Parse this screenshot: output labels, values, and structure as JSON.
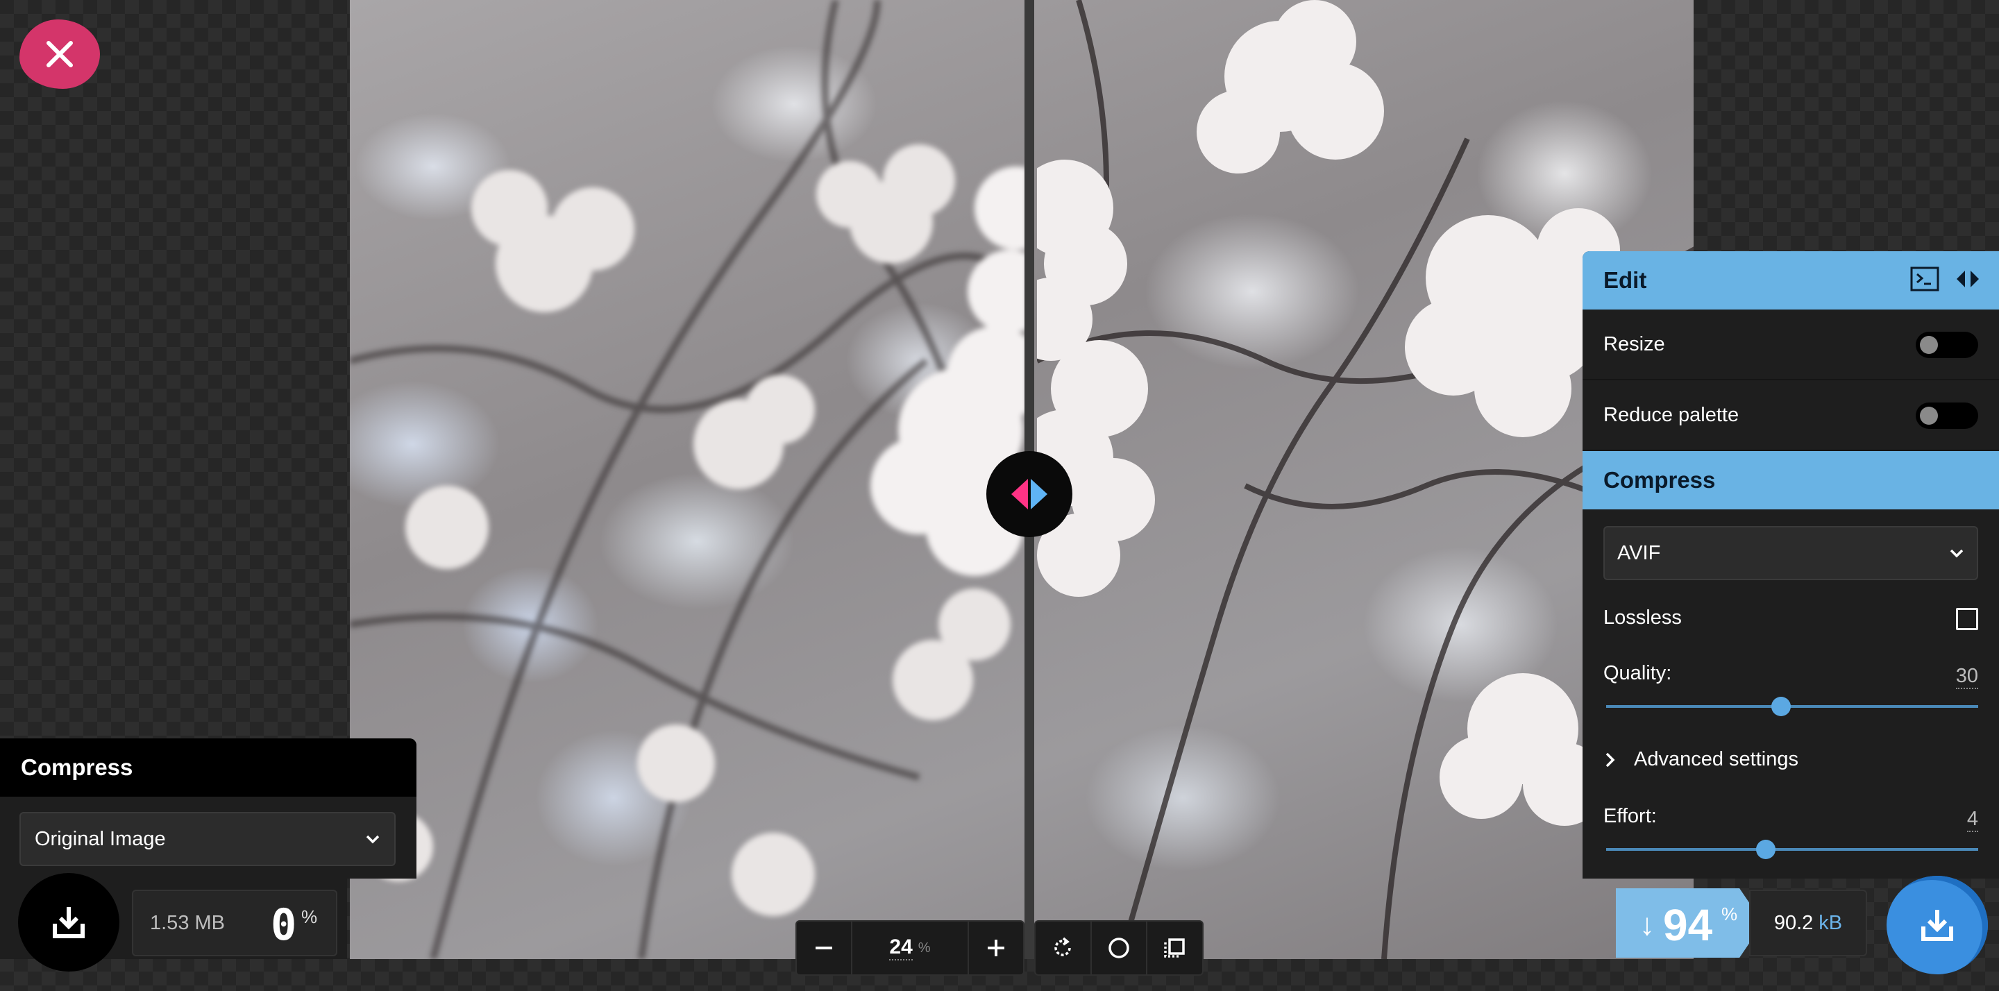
{
  "close_button": {
    "icon": "close-icon",
    "color": "#d4356a"
  },
  "left_panel": {
    "title": "Compress",
    "select_value": "Original Image",
    "download_icon": "download-icon",
    "file_size": "1.53 MB",
    "percent_value": "0",
    "percent_symbol": "%"
  },
  "zoom": {
    "value": "24",
    "unit": "%",
    "zoom_out_icon": "minus-icon",
    "zoom_in_icon": "plus-icon"
  },
  "tools": [
    "rotate-icon",
    "circle-icon",
    "crop-icon"
  ],
  "right_panel": {
    "header_title": "Edit",
    "header_icons": [
      "terminal-icon",
      "expand-arrows-icon"
    ],
    "resize_label": "Resize",
    "resize_on": false,
    "reduce_palette_label": "Reduce palette",
    "reduce_palette_on": false,
    "section_title": "Compress",
    "format_value": "AVIF",
    "lossless_label": "Lossless",
    "lossless_checked": false,
    "quality_label": "Quality:",
    "quality_value": "30",
    "quality_fraction": 0.47,
    "advanced_label": "Advanced settings",
    "effort_label": "Effort:",
    "effort_value": "4",
    "effort_fraction": 0.43
  },
  "result": {
    "arrow": "↓",
    "percent": "94",
    "percent_symbol": "%",
    "size_value": "90.2",
    "size_unit": "kB",
    "download_icon": "download-icon"
  },
  "colors": {
    "accent_blue": "#69b3e4",
    "accent_pink": "#ff3385",
    "download_blue": "#3a8fe0"
  }
}
